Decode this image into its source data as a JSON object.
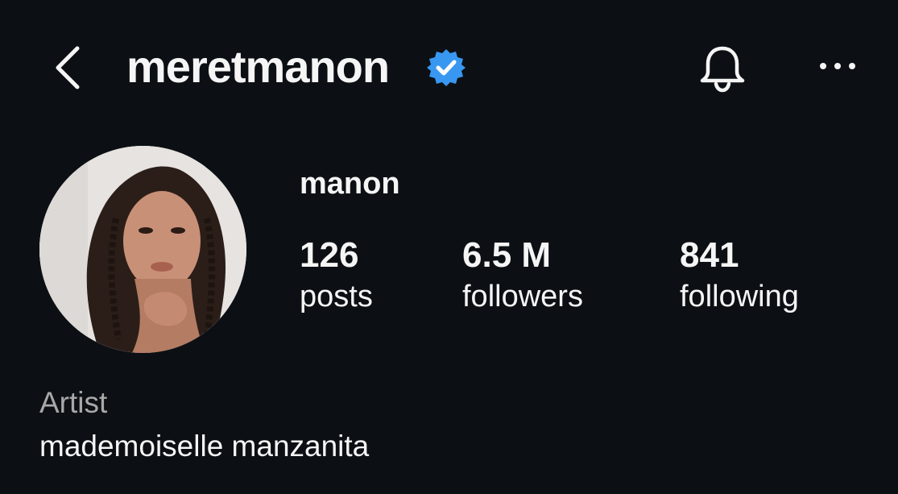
{
  "header": {
    "username": "meretmanon",
    "verified": true,
    "back_icon": "chevron-left-icon",
    "notification_icon": "bell-icon",
    "more_icon": "ellipsis-icon",
    "verified_color": "#3897f0"
  },
  "profile": {
    "display_name": "manon",
    "avatar": "profile-photo",
    "stats": {
      "posts": {
        "value": "126",
        "label": "posts"
      },
      "followers": {
        "value": "6.5 M",
        "label": "followers"
      },
      "following": {
        "value": "841",
        "label": "following"
      }
    },
    "category": "Artist",
    "bio": "mademoiselle manzanita"
  },
  "colors": {
    "background": "#0c1014",
    "text_primary": "#f5f5f5",
    "text_secondary": "#a8a8a8"
  }
}
